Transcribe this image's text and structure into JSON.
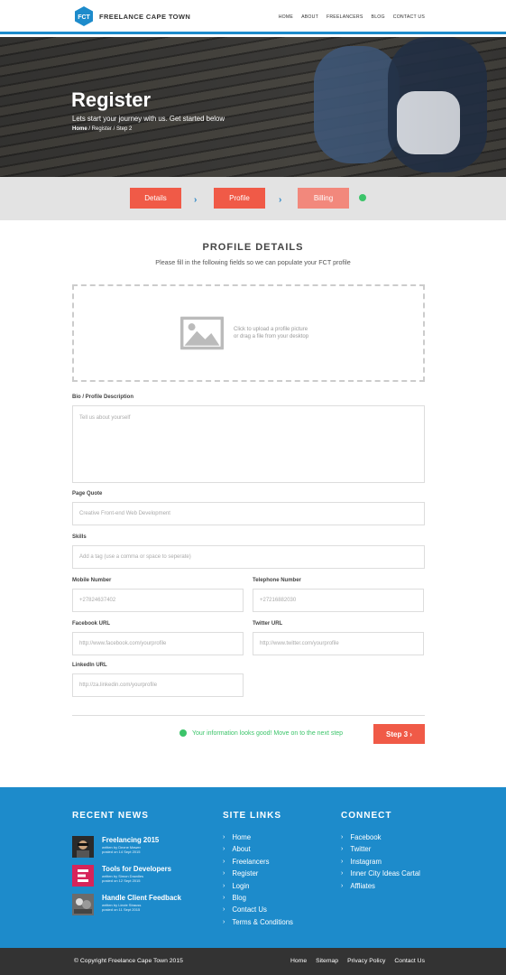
{
  "header": {
    "logo_text": "FCT",
    "brand": "FREELANCE CAPE TOWN",
    "nav": [
      "HOME",
      "ABOUT",
      "FREELANCERS",
      "BLOG",
      "CONTACT US"
    ]
  },
  "hero": {
    "title": "Register",
    "subtitle": "Lets start your journey with us. Get started below",
    "breadcrumb_home": "Home",
    "breadcrumb_rest": " / Register / Step 2"
  },
  "steps": {
    "items": [
      "Details",
      "Profile",
      "Billing"
    ]
  },
  "form": {
    "title": "PROFILE DETAILS",
    "subtitle": "Please fill in the following fields so we can populate your FCT profile",
    "upload_line1": "Click to upload a profile picture",
    "upload_line2": "or drag a file from your desktop",
    "bio_label": "Bio / Profile Description",
    "bio_placeholder": "Tell us about yourself",
    "quote_label": "Page Quote",
    "quote_placeholder": "Creative Front-end Web Development",
    "skills_label": "Skills",
    "skills_placeholder": "Add a tag (use a comma or space to seperate)",
    "mobile_label": "Mobile Number",
    "mobile_placeholder": "+27824637402",
    "phone_label": "Telephone Number",
    "phone_placeholder": "+27216882030",
    "facebook_label": "Facebook URL",
    "facebook_placeholder": "http://www.facebook.com/yourprofile",
    "twitter_label": "Twitter URL",
    "twitter_placeholder": "http://www.twitter.com/yourprofile",
    "linkedin_label": "LinkedIn URL",
    "linkedin_placeholder": "http://za.linkedin.com/yourprofile",
    "ok_message": "Your information looks good! Move on to the next step",
    "next_button": "Step 3 ›"
  },
  "footer": {
    "news_heading": "RECENT NEWS",
    "news": [
      {
        "title": "Freelancing 2015",
        "by": "written by Dezne Mawer",
        "date": "posted on 14 Sept 2015"
      },
      {
        "title": "Tools for Developers",
        "by": "written by Simon Dowdles",
        "date": "posted on 12 Sept 2015"
      },
      {
        "title": "Handle Client Feedback",
        "by": "written by Liezie Strauss",
        "date": "posted on 11 Sept 2015"
      }
    ],
    "links_heading": "SITE LINKS",
    "links": [
      "Home",
      "About",
      "Freelancers",
      "Register",
      "Login",
      "Blog",
      "Contact Us",
      "Terms & Conditions"
    ],
    "connect_heading": "CONNECT",
    "connect": [
      "Facebook",
      "Twitter",
      "Instagram",
      "Inner City Ideas Cartal",
      "Affliates"
    ],
    "copyright": "© Copyright Freelance Cape Town 2015",
    "bottom_links": [
      "Home",
      "Sitemap",
      "Privacy Policy",
      "Contact Us"
    ]
  },
  "colors": {
    "accent": "#f05a47",
    "brand_blue": "#1d8bcb",
    "success": "#3cc46a"
  }
}
